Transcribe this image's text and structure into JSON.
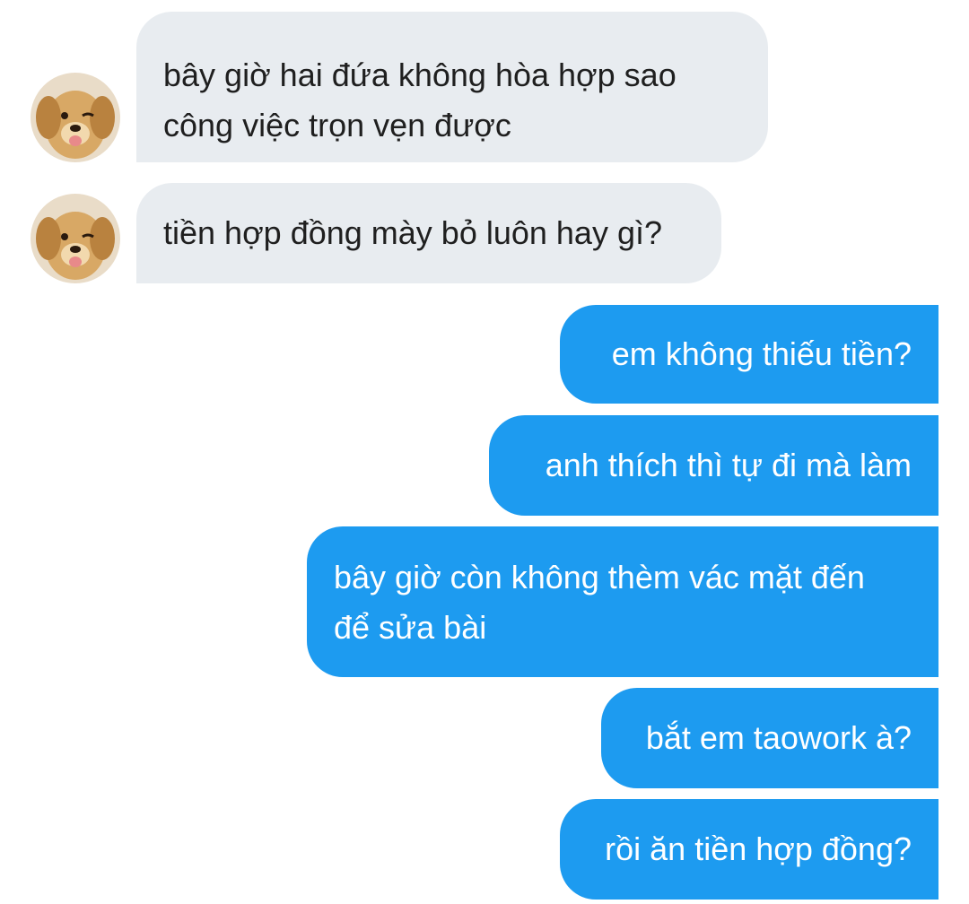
{
  "messages": [
    {
      "id": "m1",
      "from": "other",
      "lines": [
        "bây giờ hai đứa không hòa hợp sao",
        "công việc trọn vẹn được"
      ]
    },
    {
      "id": "m2",
      "from": "other",
      "lines": [
        "tiền hợp đồng mày bỏ luôn hay gì?"
      ]
    },
    {
      "id": "m3",
      "from": "me",
      "lines": [
        "em không thiếu tiền?"
      ]
    },
    {
      "id": "m4",
      "from": "me",
      "lines": [
        "anh thích thì tự đi mà làm"
      ]
    },
    {
      "id": "m5",
      "from": "me",
      "lines": [
        "bây giờ còn không thèm vác mặt đến",
        "để sửa bài"
      ]
    },
    {
      "id": "m6",
      "from": "me",
      "lines": [
        "bắt em taowork à?"
      ]
    },
    {
      "id": "m7",
      "from": "me",
      "lines": [
        "rồi ăn tiền hợp đồng?"
      ]
    }
  ],
  "colors": {
    "incoming_bubble": "#e8ecf0",
    "outgoing_bubble": "#1d9bf0",
    "incoming_text": "#1f1f1f",
    "outgoing_text": "#ffffff"
  },
  "avatar": {
    "icon": "dog-avatar-icon"
  }
}
